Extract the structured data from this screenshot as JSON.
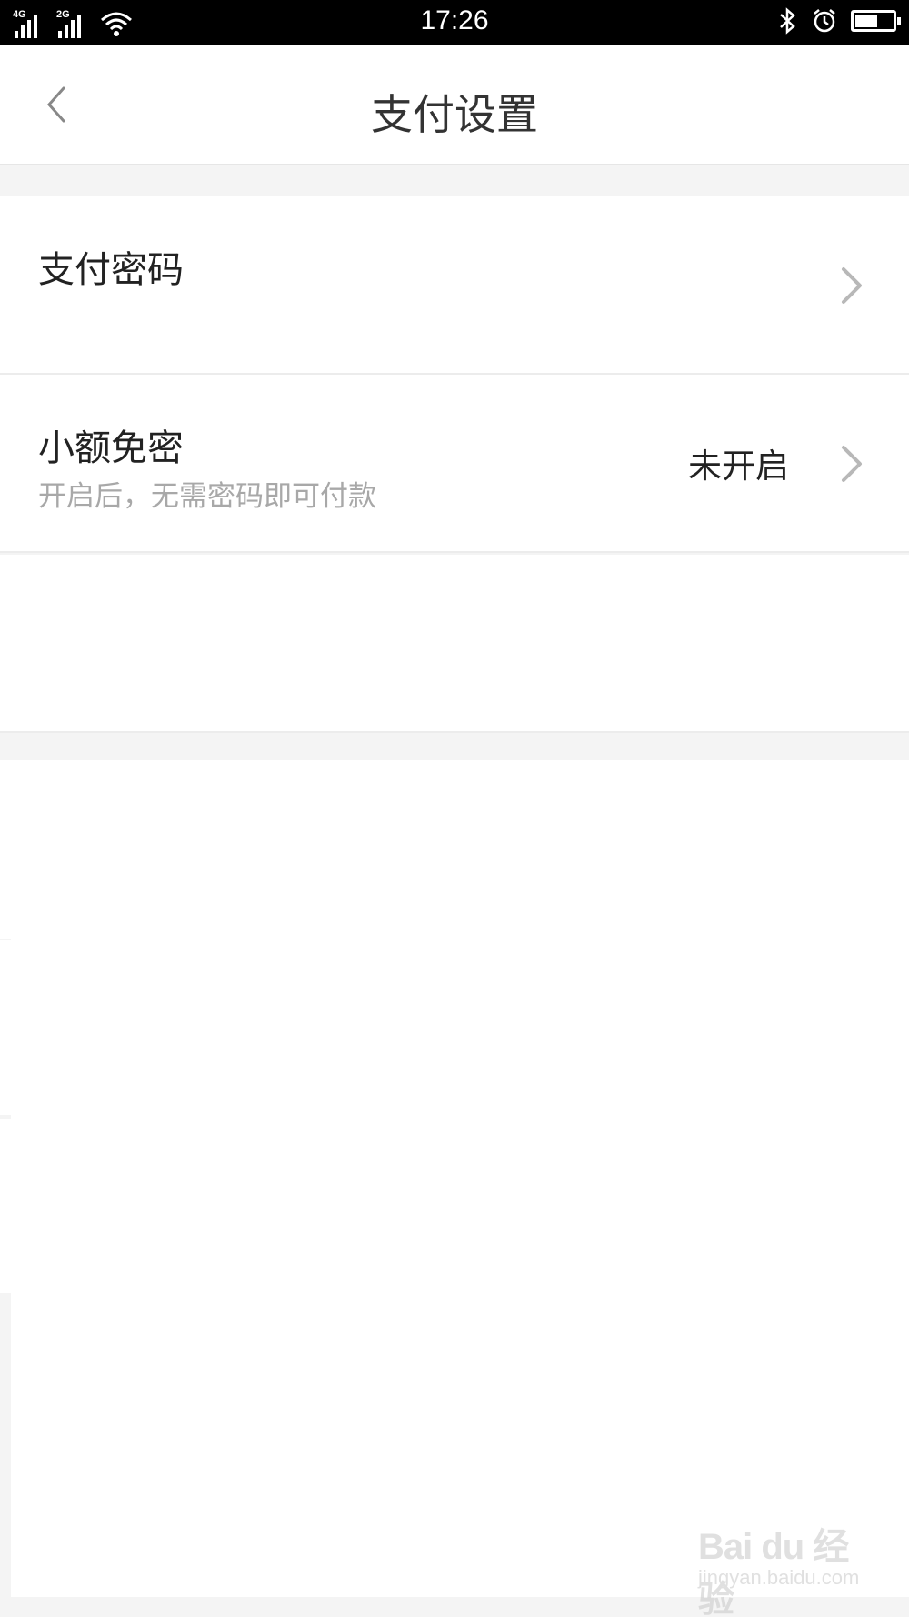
{
  "status_bar": {
    "time": "17:26",
    "network_1": "4G",
    "network_2": "2G",
    "battery_level": 0.6,
    "icons": [
      "wifi-icon",
      "bluetooth-icon",
      "alarm-icon",
      "battery-icon"
    ]
  },
  "header": {
    "title": "支付设置",
    "back_icon": "chevron-left-icon"
  },
  "settings": {
    "items": [
      {
        "title": "支付密码",
        "subtitle": "",
        "value": "",
        "icon": "chevron-right-icon"
      },
      {
        "title": "小额免密",
        "subtitle": "开启后，无需密码即可付款",
        "value": "未开启",
        "icon": "chevron-right-icon"
      }
    ]
  },
  "watermark": {
    "logo": "Bai du 经验",
    "url": "jingyan.baidu.com"
  }
}
